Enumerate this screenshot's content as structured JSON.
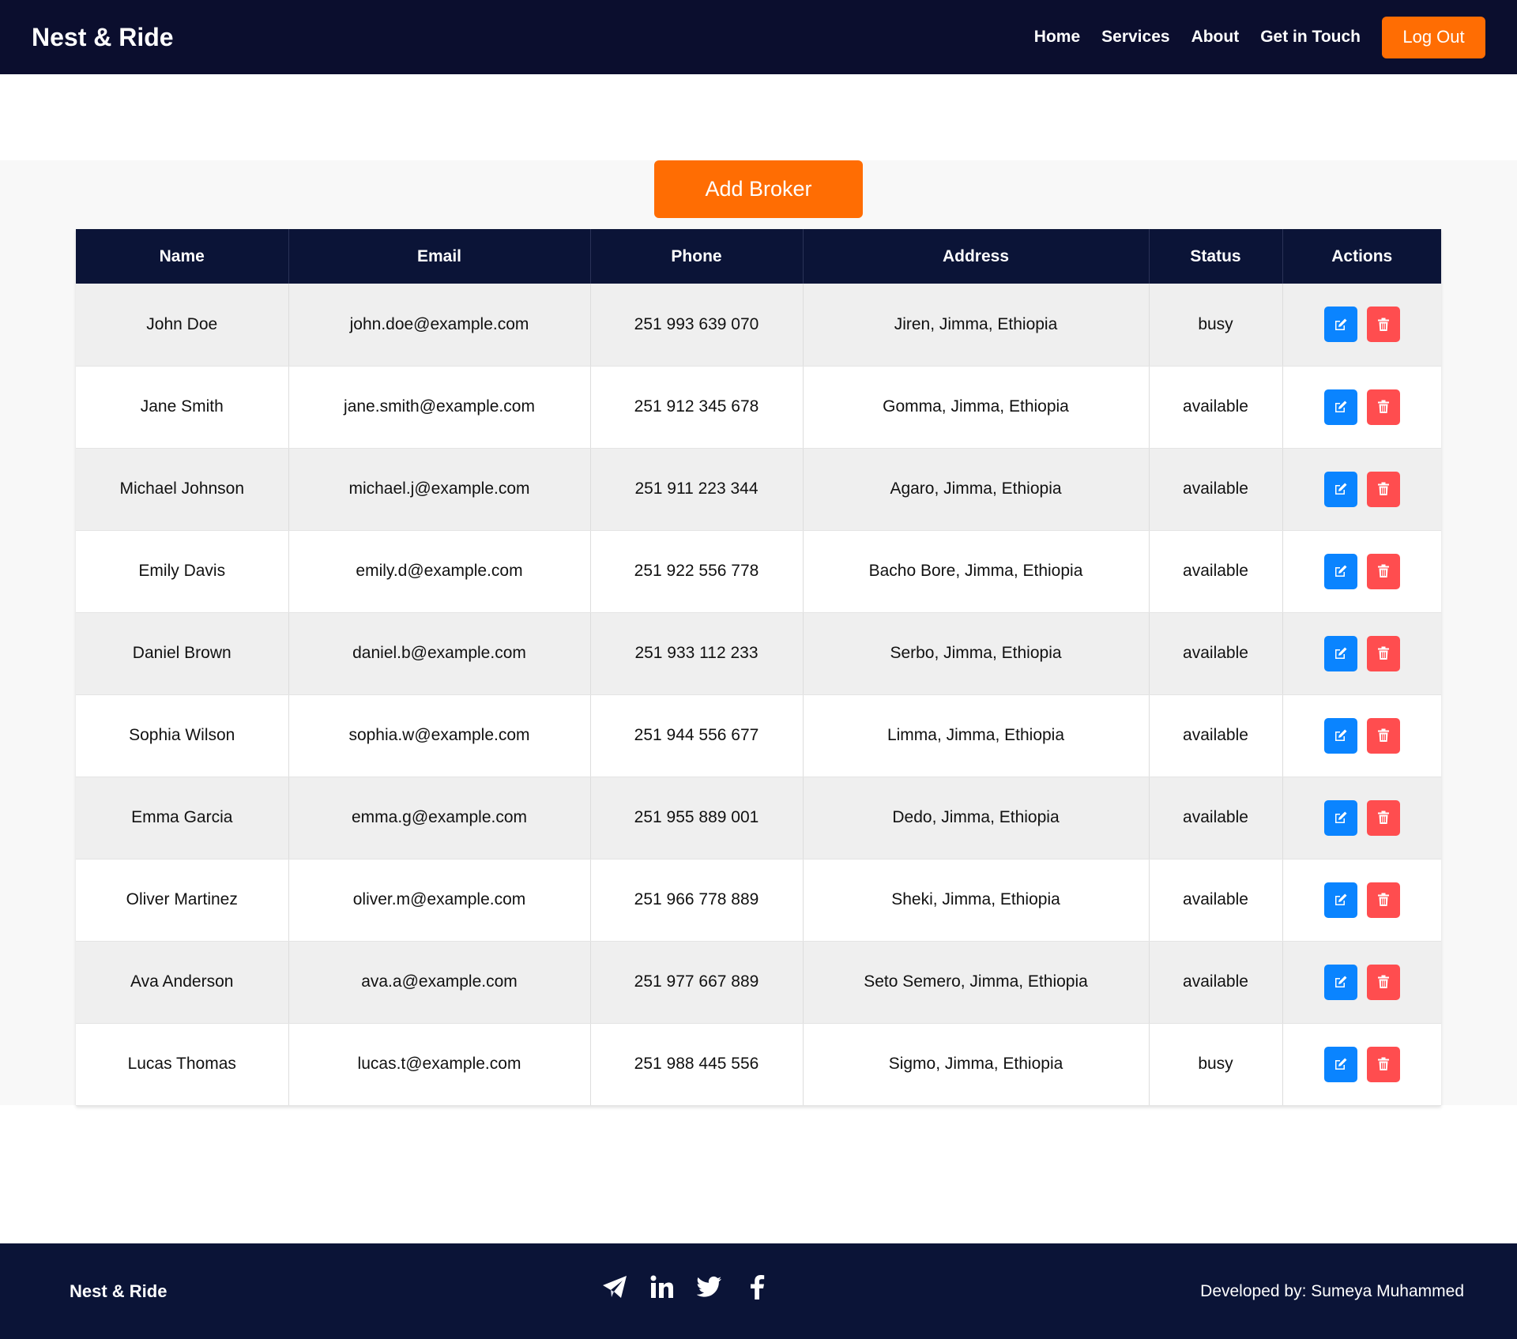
{
  "header": {
    "brand": "Nest & Ride",
    "nav": [
      "Home",
      "Services",
      "About",
      "Get in Touch"
    ],
    "logout_label": "Log Out"
  },
  "main": {
    "add_label": "Add Broker",
    "columns": [
      "Name",
      "Email",
      "Phone",
      "Address",
      "Status",
      "Actions"
    ],
    "rows": [
      {
        "name": "John Doe",
        "email": "john.doe@example.com",
        "phone": "251 993 639 070",
        "address": "Jiren, Jimma, Ethiopia",
        "status": "busy"
      },
      {
        "name": "Jane Smith",
        "email": "jane.smith@example.com",
        "phone": "251 912 345 678",
        "address": "Gomma, Jimma, Ethiopia",
        "status": "available"
      },
      {
        "name": "Michael Johnson",
        "email": "michael.j@example.com",
        "phone": "251 911 223 344",
        "address": "Agaro, Jimma, Ethiopia",
        "status": "available"
      },
      {
        "name": "Emily Davis",
        "email": "emily.d@example.com",
        "phone": "251 922 556 778",
        "address": "Bacho Bore, Jimma, Ethiopia",
        "status": "available"
      },
      {
        "name": "Daniel Brown",
        "email": "daniel.b@example.com",
        "phone": "251 933 112 233",
        "address": "Serbo, Jimma, Ethiopia",
        "status": "available"
      },
      {
        "name": "Sophia Wilson",
        "email": "sophia.w@example.com",
        "phone": "251 944 556 677",
        "address": "Limma, Jimma, Ethiopia",
        "status": "available"
      },
      {
        "name": "Emma Garcia",
        "email": "emma.g@example.com",
        "phone": "251 955 889 001",
        "address": "Dedo, Jimma, Ethiopia",
        "status": "available"
      },
      {
        "name": "Oliver Martinez",
        "email": "oliver.m@example.com",
        "phone": "251 966 778 889",
        "address": "Sheki, Jimma, Ethiopia",
        "status": "available"
      },
      {
        "name": "Ava Anderson",
        "email": "ava.a@example.com",
        "phone": "251 977 667 889",
        "address": "Seto Semero, Jimma, Ethiopia",
        "status": "available"
      },
      {
        "name": "Lucas Thomas",
        "email": "lucas.t@example.com",
        "phone": "251 988 445 556",
        "address": "Sigmo, Jimma, Ethiopia",
        "status": "busy"
      }
    ],
    "action_icons": [
      "edit-icon",
      "trash-icon"
    ]
  },
  "footer": {
    "brand": "Nest & Ride",
    "social_icons": [
      "telegram-icon",
      "linkedin-icon",
      "twitter-icon",
      "facebook-icon"
    ],
    "credit": "Developed by: Sumeya Muhammed"
  },
  "colors": {
    "header_bg": "#0b0e2e",
    "footer_bg": "#0b1437",
    "accent": "#ff6d03",
    "edit": "#0a84ff",
    "delete": "#ff4d4f"
  }
}
